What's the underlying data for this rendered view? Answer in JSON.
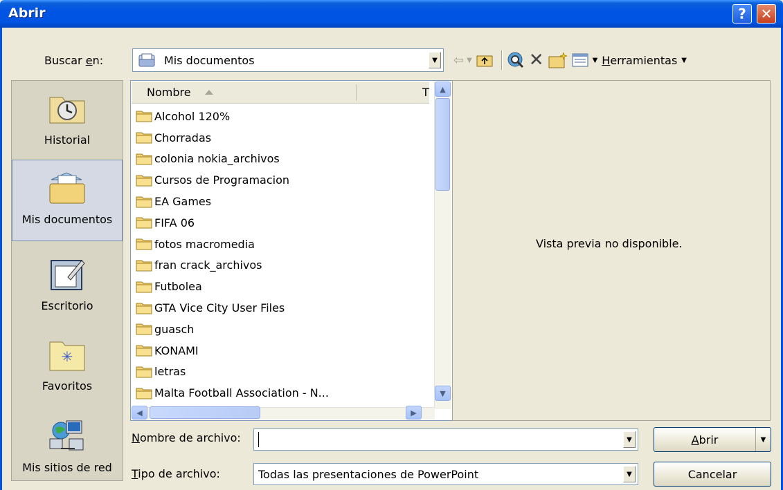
{
  "window": {
    "title": "Abrir",
    "help_glyph": "?",
    "close_glyph": "✕"
  },
  "lookin": {
    "label": "Buscar en:",
    "value": "Mis documentos"
  },
  "toolbar": {
    "tools_label": "Herramientas"
  },
  "places": [
    {
      "label": "Historial",
      "icon": "history-icon"
    },
    {
      "label": "Mis documentos",
      "icon": "my-documents-icon",
      "selected": true
    },
    {
      "label": "Escritorio",
      "icon": "desktop-icon"
    },
    {
      "label": "Favoritos",
      "icon": "favorites-icon"
    },
    {
      "label": "Mis sitios de red",
      "icon": "network-places-icon"
    }
  ],
  "filelist": {
    "header_name": "Nombre",
    "header_type": "T",
    "items": [
      "Alcohol 120%",
      "Chorradas",
      "colonia nokia_archivos",
      "Cursos de Programacion",
      "EA Games",
      "FIFA 06",
      "fotos macromedia",
      "fran crack_archivos",
      "Futbolea",
      "GTA Vice City User Files",
      "guasch",
      "KONAMI",
      "letras",
      "Malta Football Association - N..."
    ]
  },
  "preview": {
    "message": "Vista previa no disponible."
  },
  "filename": {
    "label": "Nombre de archivo:",
    "value": ""
  },
  "filetype": {
    "label": "Tipo de archivo:",
    "value": "Todas las presentaciones de PowerPoint"
  },
  "buttons": {
    "open": "Abrir",
    "cancel": "Cancelar"
  },
  "colors": {
    "titlebar": "#0054e3",
    "dialog_bg": "#ece9d8",
    "folder": "#f3d37a"
  }
}
